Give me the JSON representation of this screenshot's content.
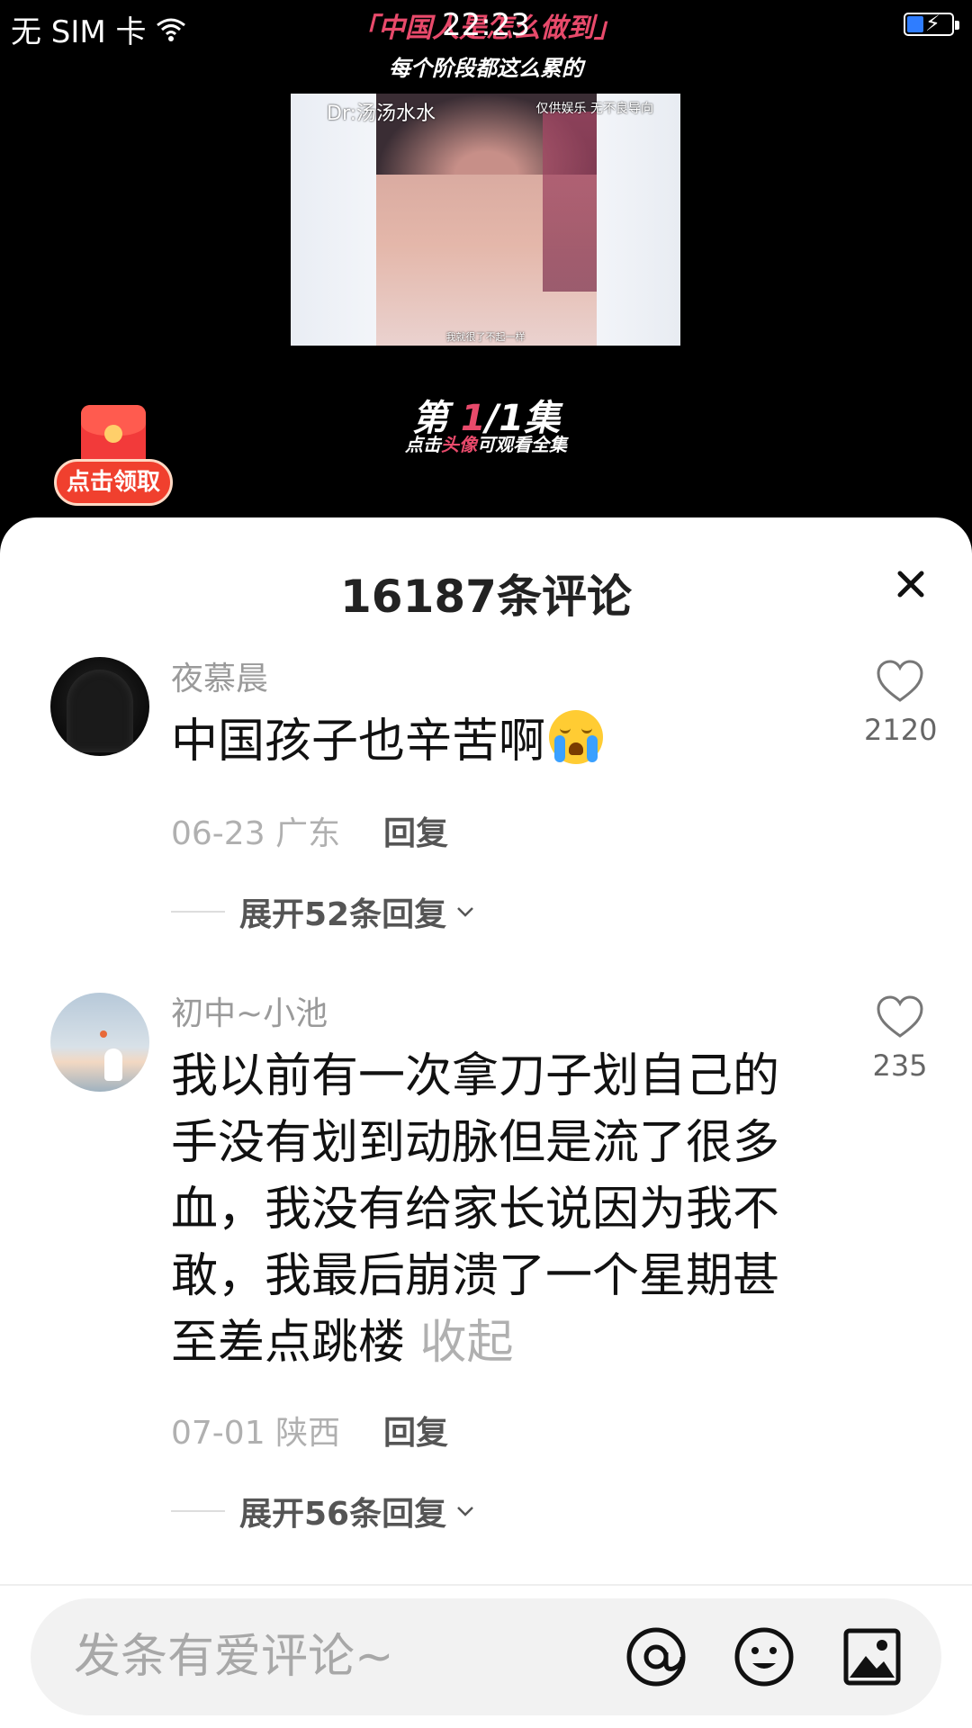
{
  "status_bar": {
    "carrier": "无 SIM 卡",
    "time": "22:23"
  },
  "video": {
    "title_top": "「中国人是怎么做到」",
    "title_sub": "每个阶段都这么累的",
    "watermark_left": "Dr:汤汤水水",
    "watermark_right": "仅供娱乐 无不良导向",
    "subtitle": "我就很了不起一样",
    "episode_prefix": "第",
    "episode_num": "1",
    "episode_suffix": "/1集",
    "episode_hint_pre": "点击",
    "episode_hint_hl": "头像",
    "episode_hint_post": "可观看全集"
  },
  "red_packet": {
    "label": "点击领取"
  },
  "comments_sheet": {
    "title": "16187条评论",
    "comments": [
      {
        "username": "夜慕晨",
        "text": "中国孩子也辛苦啊",
        "date": "06-23",
        "location": "广东",
        "reply_label": "回复",
        "expand_label": "展开52条回复",
        "likes": "2120"
      },
      {
        "username": "初中~小池",
        "text": "我以前有一次拿刀子划自己的手没有划到动脉但是流了很多血，我没有给家长说因为我不敢，我最后崩溃了一个星期甚至差点跳楼",
        "collapse_label": "收起",
        "date": "07-01",
        "location": "陕西",
        "reply_label": "回复",
        "expand_label": "展开56条回复",
        "likes": "235"
      }
    ]
  },
  "input_bar": {
    "placeholder": "发条有爱评论~"
  },
  "colors": {
    "accent_pink": "#e84a6b",
    "red_packet": "#f0402e",
    "battery_fill": "#2f7dff"
  }
}
